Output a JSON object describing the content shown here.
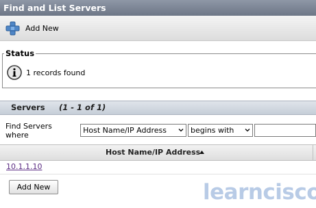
{
  "page": {
    "title": "Find and List Servers"
  },
  "toolbar": {
    "add_new_label": "Add New",
    "add_icon": "add-plus-icon"
  },
  "status": {
    "legend": "Status",
    "icon": "info-icon",
    "message": "1 records found"
  },
  "servers": {
    "title": "Servers",
    "count_text": "(1 - 1 of 1)"
  },
  "find": {
    "label": "Find Servers where",
    "field_select": {
      "value": "Host Name/IP Address"
    },
    "operator_select": {
      "value": "begins with"
    },
    "search_value": ""
  },
  "table": {
    "columns": [
      {
        "label": "Host Name/IP Address",
        "sort": "ascending"
      }
    ],
    "rows": [
      {
        "host": "10.1.1.10"
      }
    ]
  },
  "bottom": {
    "add_new_label": "Add New"
  },
  "watermark": {
    "text": "learncisco"
  },
  "colors": {
    "title_bar": "#7b8494",
    "section_header": "#d3d9e1",
    "link": "#5a2a82",
    "watermark": "#b8cbe6",
    "plus_icon": "#4f86c6"
  }
}
